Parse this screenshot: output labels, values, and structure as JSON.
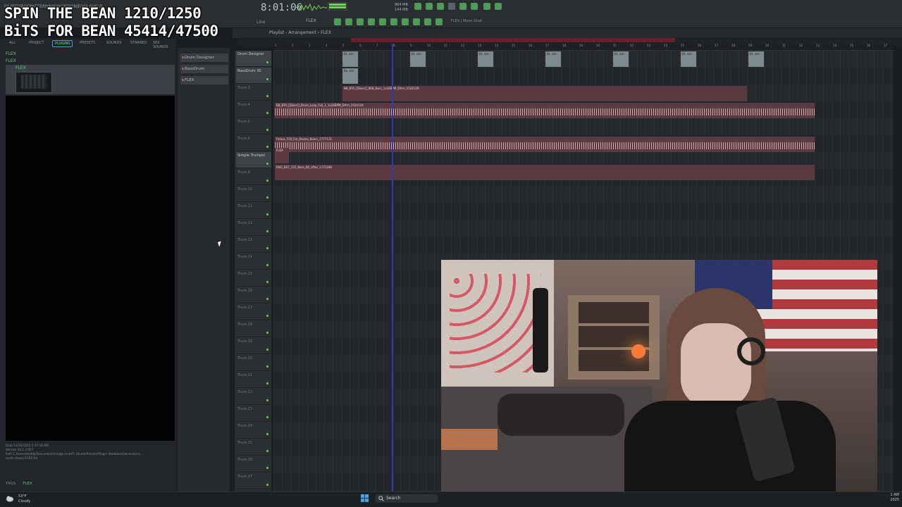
{
  "overlay": {
    "line1": "SPIN THE BEAN 1210/1250",
    "line2": "BiTS FOR BEAN 45414/47500"
  },
  "toolbar": {
    "menu": [
      "FILE",
      "EDIT",
      "ADD",
      "PATTERNS",
      "VIEW",
      "OPTIONS",
      "TOOLS",
      "HELP"
    ],
    "clock": "8:01:06",
    "pattern_name": "FLEX",
    "pattern_info": "FLEX | Moon Dust",
    "mem": "864 MB\n144 MB",
    "line_mode": "Line"
  },
  "browser": {
    "tabs": [
      "ALL",
      "PROJECT",
      "PLUGINS",
      "PRESETS",
      "SOUNDS",
      "STARRED",
      "SEX SOUNDS"
    ],
    "active_tab": "PLUGINS",
    "tree": [
      "FLEX",
      "FLEX",
      "FLEX"
    ],
    "info": [
      "Date    11/16/2022 2:47:24 AM",
      "Version 20.1.2.917",
      "Path    C:\\Users\\beddy\\Documents\\Image-Line\\FL Studio\\Presets\\Plugin database\\Generators\\...",
      "        synth classic\\FLEX.fst"
    ],
    "tags_label": "TAGS",
    "tags_value": "FLEX"
  },
  "channels": [
    "Drum Designer",
    "BassDrum",
    "FLEX"
  ],
  "playlist": {
    "title": "Playlist - Arrangement › FLEX",
    "ruler": [
      "1",
      "2",
      "3",
      "4",
      "5",
      "6",
      "7",
      "8",
      "9",
      "10",
      "11",
      "12",
      "13",
      "14",
      "15",
      "16",
      "17",
      "18",
      "19",
      "20",
      "21",
      "22",
      "23",
      "24",
      "25",
      "26",
      "27",
      "28",
      "29",
      "30",
      "31",
      "32",
      "33",
      "34",
      "35",
      "36",
      "37"
    ],
    "tracks": [
      {
        "label": "Drum Designer",
        "named": true
      },
      {
        "label": "BassDrum 30",
        "named": true
      },
      {
        "label": "Track 3",
        "named": false
      },
      {
        "label": "Track 4",
        "named": false
      },
      {
        "label": "Track 5",
        "named": false
      },
      {
        "label": "Track 6",
        "named": false
      },
      {
        "label": "Simple Trumpet",
        "named": true
      },
      {
        "label": "Track 8",
        "named": false
      },
      {
        "label": "Track 10",
        "named": false
      },
      {
        "label": "Track 11",
        "named": false
      },
      {
        "label": "Track 12",
        "named": false
      },
      {
        "label": "Track 13",
        "named": false
      },
      {
        "label": "Track 14",
        "named": false
      },
      {
        "label": "Track 15",
        "named": false
      },
      {
        "label": "Track 16",
        "named": false
      },
      {
        "label": "Track 17",
        "named": false
      },
      {
        "label": "Track 18",
        "named": false
      },
      {
        "label": "Track 19",
        "named": false
      },
      {
        "label": "Track 20",
        "named": false
      },
      {
        "label": "Track 21",
        "named": false
      },
      {
        "label": "Track 22",
        "named": false
      },
      {
        "label": "Track 23",
        "named": false
      },
      {
        "label": "Track 24",
        "named": false
      },
      {
        "label": "Track 25",
        "named": false
      },
      {
        "label": "Track 26",
        "named": false
      },
      {
        "label": "Track 27",
        "named": false
      }
    ],
    "clips": {
      "dr": "Dr..ner",
      "ba": "Ba..um",
      "bass": "BB_BTA_[[Bass]]_808_Bass_1x16BPM_D#m_1524129",
      "drumloop": "BB_BTA_[[Bass]]_Drum_Loop_Full_1_1x16BPM_D#m_1524119",
      "fatass": "Fatass_150_Fm_Drums_Bears_1777172",
      "flex": "FLEX",
      "b07": "RNG_B07_155_Bass_08_Lifter_1771248"
    }
  },
  "taskbar": {
    "temp": "53°F",
    "weather": "Cloudy",
    "search": "Search",
    "time": "1 AM",
    "date": "2025"
  }
}
